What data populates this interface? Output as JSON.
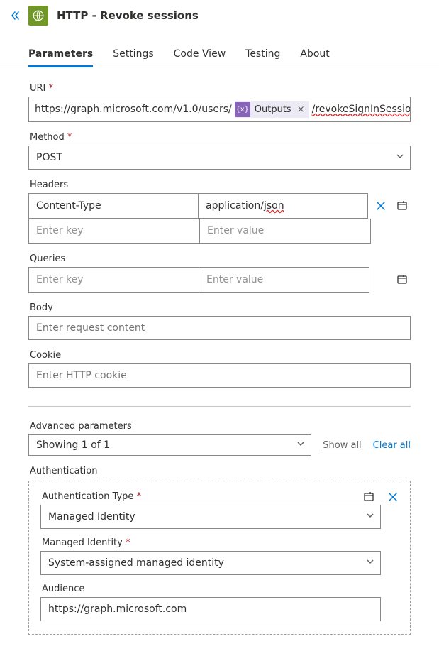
{
  "header": {
    "title": "HTTP - Revoke sessions"
  },
  "tabs": [
    "Parameters",
    "Settings",
    "Code View",
    "Testing",
    "About"
  ],
  "active_tab": 0,
  "uri": {
    "label": "URI",
    "prefix": "https://graph.microsoft.com/v1.0/users/",
    "token_label": "Outputs",
    "suffix": "/revokeSignInSessions"
  },
  "method": {
    "label": "Method",
    "value": "POST"
  },
  "headers": {
    "label": "Headers",
    "rows": [
      {
        "key": "Content-Type",
        "value": "application/json"
      }
    ],
    "key_placeholder": "Enter key",
    "value_placeholder": "Enter value"
  },
  "queries": {
    "label": "Queries",
    "key_placeholder": "Enter key",
    "value_placeholder": "Enter value"
  },
  "body": {
    "label": "Body",
    "placeholder": "Enter request content"
  },
  "cookie": {
    "label": "Cookie",
    "placeholder": "Enter HTTP cookie"
  },
  "advanced": {
    "label": "Advanced parameters",
    "showing": "Showing 1 of 1",
    "show_all": "Show all",
    "clear_all": "Clear all"
  },
  "authentication": {
    "section_label": "Authentication",
    "type_label": "Authentication Type",
    "type_value": "Managed Identity",
    "mi_label": "Managed Identity",
    "mi_value": "System-assigned managed identity",
    "audience_label": "Audience",
    "audience_value": "https://graph.microsoft.com"
  }
}
